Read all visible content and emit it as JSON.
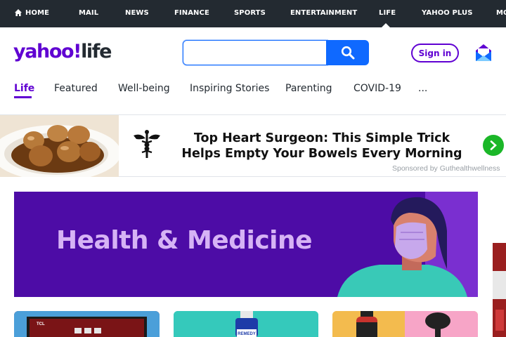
{
  "top_nav": {
    "items": [
      {
        "label": "HOME",
        "name": "nav-home"
      },
      {
        "label": "MAIL",
        "name": "nav-mail"
      },
      {
        "label": "NEWS",
        "name": "nav-news"
      },
      {
        "label": "FINANCE",
        "name": "nav-finance"
      },
      {
        "label": "SPORTS",
        "name": "nav-sports"
      },
      {
        "label": "ENTERTAINMENT",
        "name": "nav-entertainment"
      },
      {
        "label": "LIFE",
        "name": "nav-life"
      },
      {
        "label": "YAHOO PLUS",
        "name": "nav-yahoo-plus"
      },
      {
        "label": "MO",
        "name": "nav-more"
      }
    ],
    "active": "LIFE",
    "bg_color": "#232a31"
  },
  "header": {
    "logo_yahoo": "yahoo",
    "logo_bang": "!",
    "logo_life": "life",
    "search_placeholder": "",
    "search_value": "",
    "signin_label": "Sign in",
    "brand_color": "#6001d2",
    "search_button_color": "#0f69ff"
  },
  "sub_nav": {
    "tabs": [
      {
        "label": "Life",
        "active": true
      },
      {
        "label": "Featured"
      },
      {
        "label": "Well-being"
      },
      {
        "label": "Inspiring Stories"
      },
      {
        "label": "Parenting"
      },
      {
        "label": "COVID-19"
      },
      {
        "label": "..."
      }
    ]
  },
  "ad": {
    "headline_line1": "Top Heart Surgeon: This Simple Trick",
    "headline_line2": "Helps Empty Your Bowels Every Morning",
    "sponsor": "Sponsored by Guthealthwellness",
    "arrow_color": "#1bb728"
  },
  "banner": {
    "title": "Health & Medicine",
    "bg_color": "#4d0ca6",
    "title_color": "#d6b3f5"
  },
  "cards": [
    {
      "name": "card-tv",
      "label": "TCL"
    },
    {
      "name": "card-remedy",
      "label": "REMEDY"
    },
    {
      "name": "card-bottle-brush",
      "label": ""
    }
  ]
}
